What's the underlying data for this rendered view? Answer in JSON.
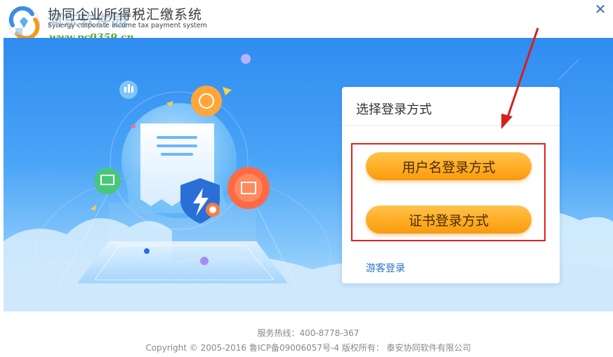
{
  "app": {
    "title_zh": "协同企业所得税汇缴系统",
    "title_en": "Synergy corporate income tax payment system"
  },
  "watermark": {
    "name": "河东软件园",
    "url": "www.pc0359.cn"
  },
  "window": {
    "close_label": "✕"
  },
  "login_card": {
    "title": "选择登录方式",
    "username_button": "用户名登录方式",
    "certificate_button": "证书登录方式",
    "guest_link": "游客登录"
  },
  "footer": {
    "hotline": "服务热线：400-8778-367",
    "copyright": "Copyright © 2005-2016  鲁ICP备09006057号-4  版权所有：  泰安协同软件有限公司"
  },
  "colors": {
    "banner_top": "#2f8cf0",
    "button_orange": "#ffad24",
    "highlight_red": "#e02020",
    "link_blue": "#2a74c8"
  }
}
